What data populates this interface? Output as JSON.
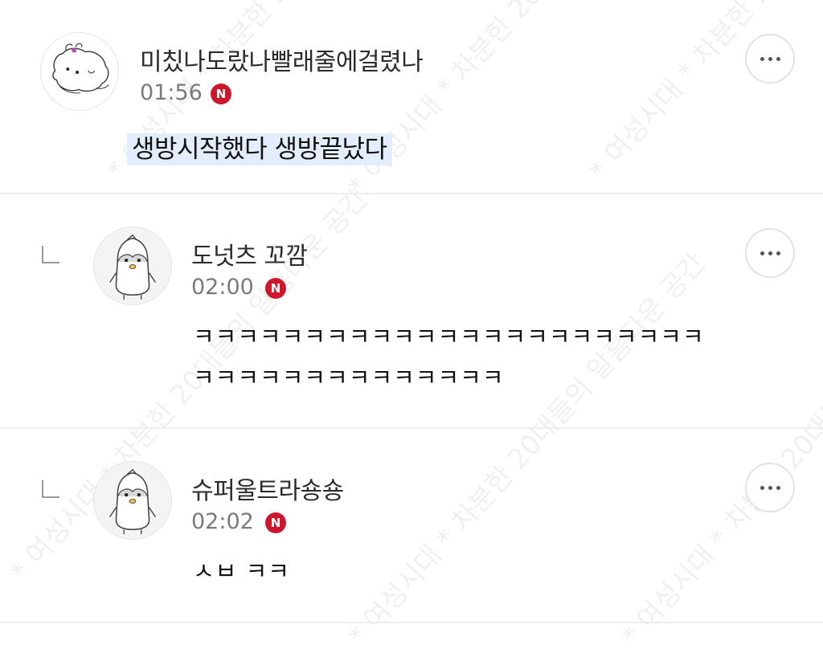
{
  "watermark": "* 여성시대 * 차분한 20대들의 알흠다운 공간",
  "comments": [
    {
      "nickname": "미칬나도랐나빨래줄에걸렸나",
      "time": "01:56",
      "badge": "N",
      "avatar_icon": "puppy-drawing-avatar",
      "text": "생방시작했다 생방끝났다",
      "highlighted": true
    },
    {
      "nickname": "도넛츠 꼬깜",
      "time": "02:00",
      "badge": "N",
      "avatar_icon": "penguin-avatar",
      "is_reply": true,
      "lines": [
        "ㅋㅋㅋㅋㅋㅋㅋㅋㅋㅋㅋㅋㅋㅋㅋㅋㅋㅋㅋㅋㅋㅋㅋ",
        "ㅋㅋㅋㅋㅋㅋㅋㅋㅋㅋㅋㅋㅋㅋ"
      ]
    },
    {
      "nickname": "슈퍼울트라숑숑",
      "time": "02:02",
      "badge": "N",
      "avatar_icon": "penguin-avatar",
      "is_reply": true,
      "lines": [
        "ㅅㅂ ㅋㅋ"
      ]
    }
  ],
  "colors": {
    "badge": "#d0162a",
    "highlight": "#e3edfb",
    "divider": "#eeeeee"
  }
}
